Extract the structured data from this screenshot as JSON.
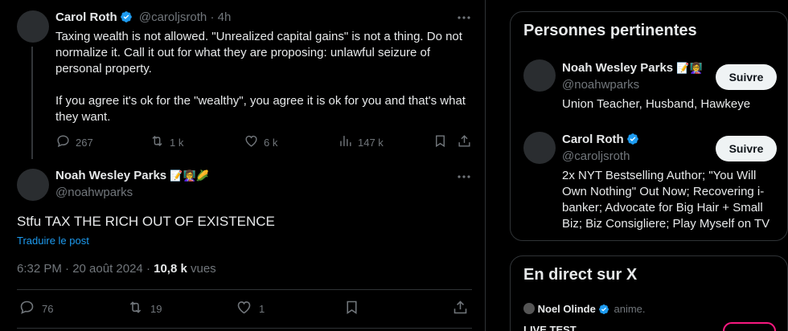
{
  "parent_tweet": {
    "name": "Carol Roth",
    "handle": "@caroljsroth",
    "time": "· 4h",
    "paragraph1": "Taxing wealth is not allowed. \"Unrealized capital gains\" is not a thing. Do not normalize it. Call it out for what they are proposing: unlawful seizure of personal property.",
    "paragraph2": "If you agree it's ok for the \"wealthy\", you agree it is ok for you and that's what they want.",
    "replies": "267",
    "retweets": "1 k",
    "likes": "6 k",
    "views": "147 k"
  },
  "main_tweet": {
    "name": "Noah Wesley Parks",
    "name_emoji": "📝👩‍🏫🌽",
    "handle": "@noahwparks",
    "text": "Stfu TAX THE RICH OUT OF EXISTENCE",
    "translate": "Traduire le post",
    "timestamp": "6:32 PM · 20 août 2024 · ",
    "views_count": "10,8 k",
    "views_label": " vues",
    "replies": "76",
    "retweets": "19",
    "likes": "1"
  },
  "relevant_people": {
    "title": "Personnes pertinentes",
    "people": [
      {
        "name": "Noah Wesley Parks",
        "name_emoji": "📝👩‍🏫",
        "handle": "@noahwparks",
        "bio": "Union Teacher, Husband, Hawkeye",
        "follow_label": "Suivre"
      },
      {
        "name": "Carol Roth",
        "handle": "@caroljsroth",
        "bio": "2x NYT Bestselling Author; \"You Will Own Nothing\" Out Now; Recovering i-banker; Advocate for Big Hair + Small Biz; Biz Consigliere; Play Myself on TV",
        "follow_label": "Suivre"
      }
    ]
  },
  "live": {
    "title": "En direct sur X",
    "host_name": "Noel Olinde",
    "host_action": "anime.",
    "stream_title": "LIVE TEST"
  },
  "colors": {
    "accent": "#1d9bf0",
    "muted": "#71767b",
    "text": "#e7e9ea",
    "border": "#2f3336"
  }
}
